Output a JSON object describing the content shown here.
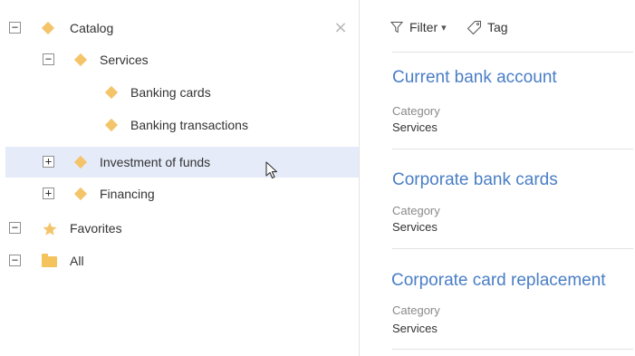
{
  "tree": {
    "nodes": [
      {
        "label": "Catalog",
        "toggle": "−",
        "icon": "diamond-icon"
      },
      {
        "label": "Services",
        "toggle": "−",
        "icon": "diamond-icon"
      },
      {
        "label": "Banking cards",
        "toggle": "",
        "icon": "diamond-icon"
      },
      {
        "label": "Banking transactions",
        "toggle": "",
        "icon": "diamond-icon"
      },
      {
        "label": "Investment of funds",
        "toggle": "+",
        "icon": "diamond-icon",
        "selected": true
      },
      {
        "label": "Financing",
        "toggle": "+",
        "icon": "diamond-icon"
      },
      {
        "label": "Favorites",
        "toggle": "−",
        "icon": "star-icon"
      },
      {
        "label": "All",
        "toggle": "−",
        "icon": "folder-icon"
      }
    ],
    "close_label": "×"
  },
  "toolbar": {
    "filter_label": "Filter",
    "filter_caret": "▾",
    "tag_label": "Tag"
  },
  "cards": [
    {
      "title": "Current bank account",
      "field_label": "Category",
      "field_value": "Services"
    },
    {
      "title": "Corporate bank cards",
      "field_label": "Category",
      "field_value": "Services"
    },
    {
      "title": "Corporate card replacement",
      "field_label": "Category",
      "field_value": "Services"
    }
  ],
  "colors": {
    "accent": "#4a7ec5",
    "selected_row": "#e5ebf8",
    "node_icon": "#f4c46b"
  }
}
